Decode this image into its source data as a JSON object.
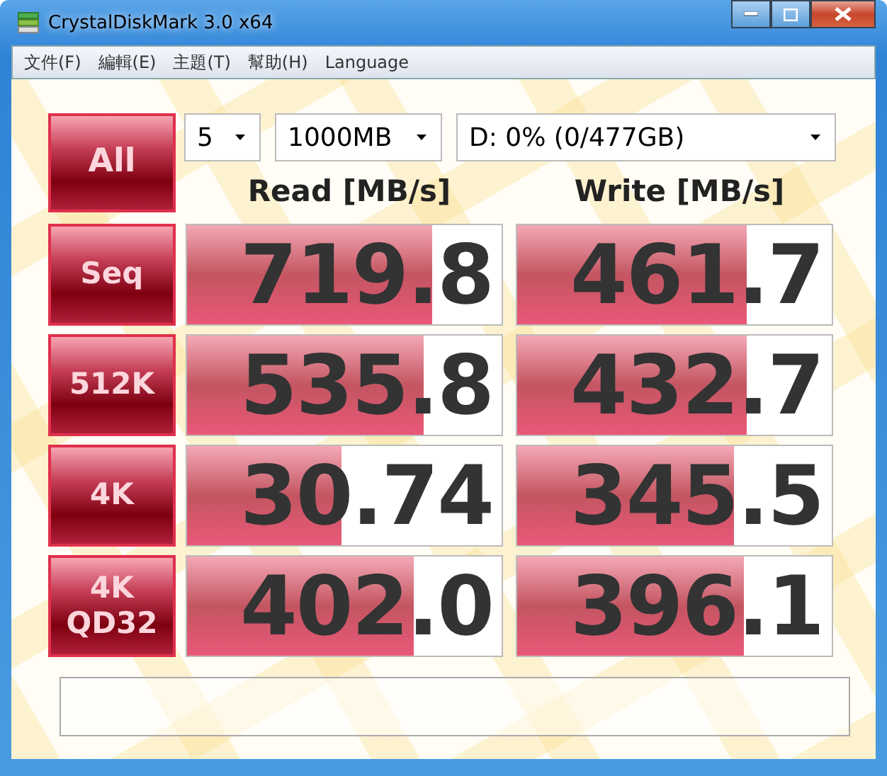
{
  "window": {
    "title": "CrystalDiskMark 3.0 x64"
  },
  "menu": [
    "文件(F)",
    "編輯(E)",
    "主題(T)",
    "幫助(H)",
    "Language"
  ],
  "all_button": "All",
  "selectors": [
    {
      "kind": "count",
      "value": "5"
    },
    {
      "kind": "size",
      "value": "1000MB"
    },
    {
      "kind": "drive",
      "value": "D: 0% (0/477GB)"
    }
  ],
  "headers": [
    "Read [MB/s]",
    "Write [MB/s]"
  ],
  "rows": [
    {
      "label": "Seq",
      "read": {
        "value": "719.8",
        "level": 0.78
      },
      "write": {
        "value": "461.7",
        "level": 0.73
      }
    },
    {
      "label": "512K",
      "read": {
        "value": "535.8",
        "level": 0.75
      },
      "write": {
        "value": "432.7",
        "level": 0.73
      }
    },
    {
      "label": "4K",
      "read": {
        "value": "30.74",
        "level": 0.49
      },
      "write": {
        "value": "345.5",
        "level": 0.69
      }
    },
    {
      "label": "4K\nQD32",
      "read": {
        "value": "402.0",
        "level": 0.72
      },
      "write": {
        "value": "396.1",
        "level": 0.72
      }
    }
  ]
}
